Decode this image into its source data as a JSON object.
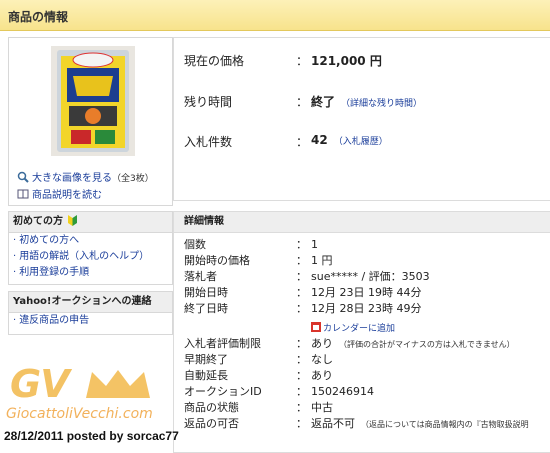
{
  "header": {
    "title": "商品の情報"
  },
  "left": {
    "enlarge_link": "大きな画像を見る",
    "enlarge_note": "（全3枚）",
    "description_link": "商品説明を読む",
    "beginner_panel": {
      "title": "初めての方",
      "links": [
        "初めての方へ",
        "用語の解説（入札のヘルプ）",
        "利用登録の手順"
      ]
    },
    "contact_panel": {
      "title": "Yahoo!オークションへの連絡",
      "links": [
        "違反商品の申告"
      ]
    }
  },
  "summary": {
    "price_label": "現在の価格",
    "price_value": "121,000 円",
    "time_label": "残り時間",
    "time_value": "終了",
    "time_link": "（詳細な残り時間）",
    "bids_label": "入札件数",
    "bids_value": "42",
    "bids_link": "（入札履歴）",
    "colon": "："
  },
  "detail": {
    "title": "詳細情報",
    "rows": [
      {
        "label": "個数",
        "value": "1"
      },
      {
        "label": "開始時の価格",
        "value": "1 円"
      },
      {
        "label": "落札者",
        "value": "sue***** / 評価：3503"
      },
      {
        "label": "開始日時",
        "value": "12月 23日 19時 44分"
      },
      {
        "label": "終了日時",
        "value": "12月 28日 23時 49分"
      },
      {
        "label": "入札者評価制限",
        "value": "あり",
        "note": "（評価の合計がマイナスの方は入札できません）"
      },
      {
        "label": "早期終了",
        "value": "なし"
      },
      {
        "label": "自動延長",
        "value": "あり"
      },
      {
        "label": "オークションID",
        "value": "150246914"
      },
      {
        "label": "商品の状態",
        "value": "中古"
      },
      {
        "label": "返品の可否",
        "value": "返品不可",
        "note": "（返品については商品情報内の『古物取扱説明"
      }
    ],
    "calendar_link": "カレンダーに追加"
  },
  "watermark": {
    "logo_text": "GV",
    "site": "GiocattoliVecchi.com"
  },
  "posted": "28/12/2011 posted by sorcac77",
  "colors": {
    "link": "#1a3d9a",
    "header_bg": "#f7e38c",
    "calendar_icon": "#d9342b"
  }
}
